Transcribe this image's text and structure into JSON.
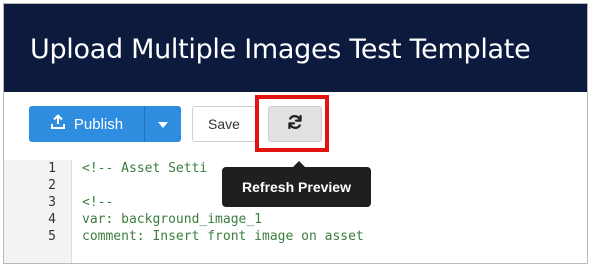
{
  "header": {
    "title": "Upload Multiple Images Test Template"
  },
  "toolbar": {
    "publish_label": "Publish",
    "publish_icon": "upload-icon",
    "publish_caret_icon": "caret-down-icon",
    "save_label": "Save",
    "refresh_icon": "refresh-icon",
    "refresh_highlighted": true
  },
  "tooltip": {
    "text": "Refresh Preview"
  },
  "editor": {
    "lines": [
      {
        "number": "1",
        "text": "<!-- Asset Setti"
      },
      {
        "number": "2",
        "text": ""
      },
      {
        "number": "3",
        "text": "<!--"
      },
      {
        "number": "4",
        "text": "var: background_image_1"
      },
      {
        "number": "5",
        "text": "comment: Insert front image on asset"
      }
    ]
  },
  "colors": {
    "title_bar_bg": "#0c1a3e",
    "primary_button": "#2f8ddf",
    "highlight": "#e2130f",
    "tooltip_bg": "#1f1f1f",
    "code_comment": "#3b7e3e"
  }
}
